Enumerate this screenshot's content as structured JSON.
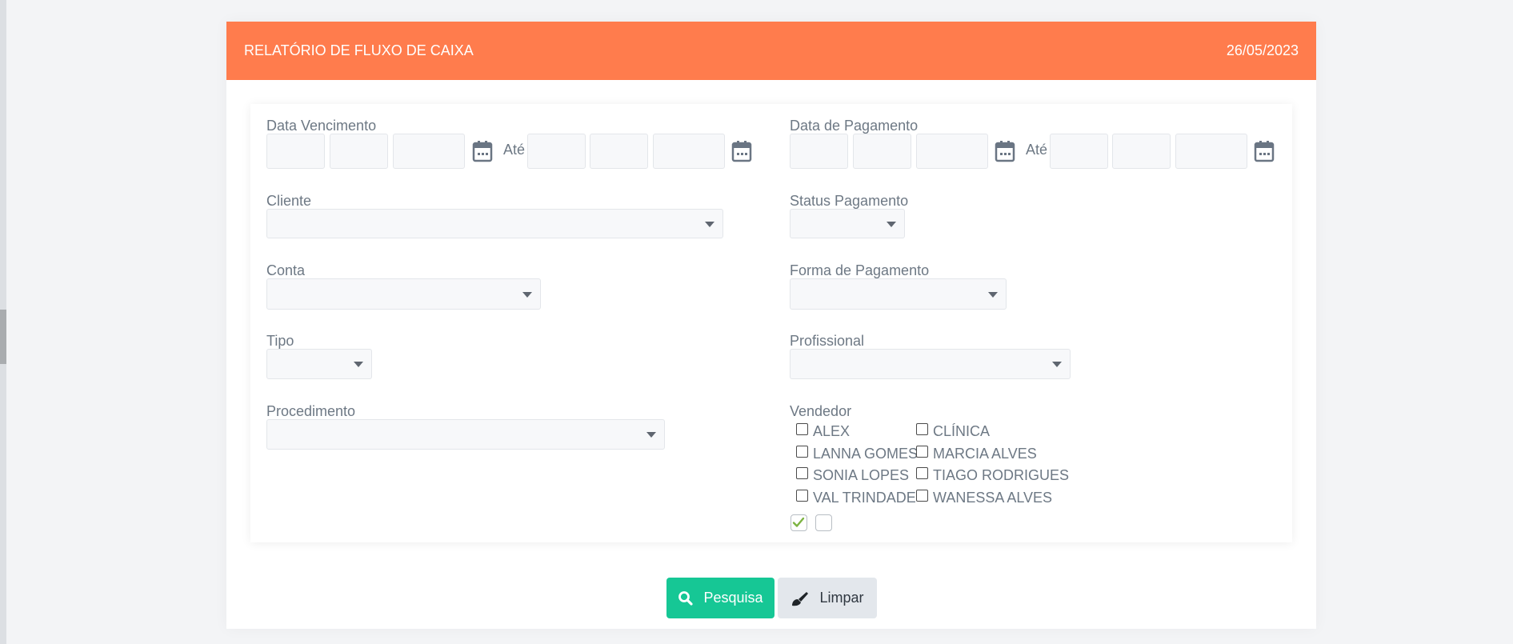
{
  "header": {
    "title": "RELATÓRIO DE FLUXO DE CAIXA",
    "date": "26/05/2023"
  },
  "form": {
    "due_date": {
      "label": "Data Vencimento",
      "until": "Até"
    },
    "payment_date": {
      "label": "Data de Pagamento",
      "until": "Até"
    },
    "client": {
      "label": "Cliente"
    },
    "payment_status": {
      "label": "Status Pagamento"
    },
    "account": {
      "label": "Conta"
    },
    "payment_method": {
      "label": "Forma de Pagamento"
    },
    "type": {
      "label": "Tipo"
    },
    "professional": {
      "label": "Profissional"
    },
    "procedure": {
      "label": "Procedimento"
    },
    "seller": {
      "label": "Vendedor",
      "options": [
        "ALEX",
        "CLÍNICA",
        "LANNA GOMES",
        "MARCIA ALVES",
        "SONIA LOPES",
        "TIAGO RODRIGUES",
        "VAL TRINDADE",
        "WANESSA ALVES"
      ]
    }
  },
  "buttons": {
    "search": "Pesquisa",
    "clear": "Limpar"
  },
  "colors": {
    "header": "#ff7c4d",
    "search_button": "#16c795",
    "clear_button": "#e3e7ec",
    "check_green": "#7cb342"
  },
  "icons": {
    "calendar": "calendar-icon",
    "search": "search-icon",
    "clear": "brush-icon",
    "select_all": "check-icon"
  }
}
